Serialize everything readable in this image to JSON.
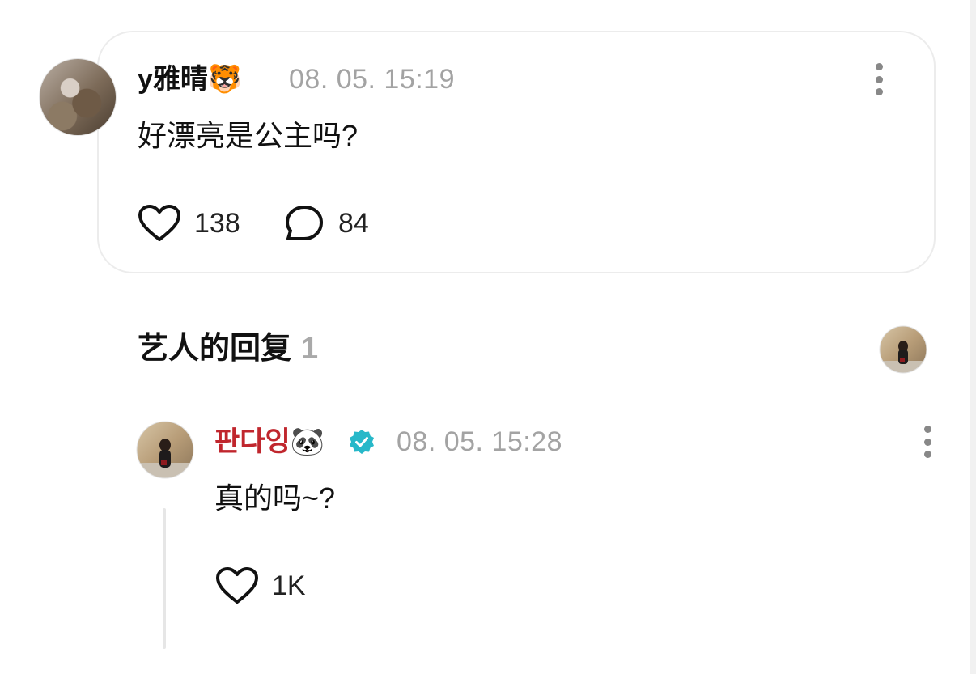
{
  "comment": {
    "username": "y雅晴🐯",
    "timestamp": "08. 05. 15:19",
    "text": "好漂亮是公主吗?",
    "likes": "138",
    "replies": "84",
    "avatar_icon": "user-avatar"
  },
  "artist_replies": {
    "title": "艺人的回复",
    "count": "1"
  },
  "reply": {
    "username": "판다잉🐼",
    "timestamp": "08. 05. 15:28",
    "text": "真的吗~?",
    "likes": "1K",
    "verified": true,
    "username_color": "#c0262d",
    "verified_color": "#27b8c9"
  }
}
